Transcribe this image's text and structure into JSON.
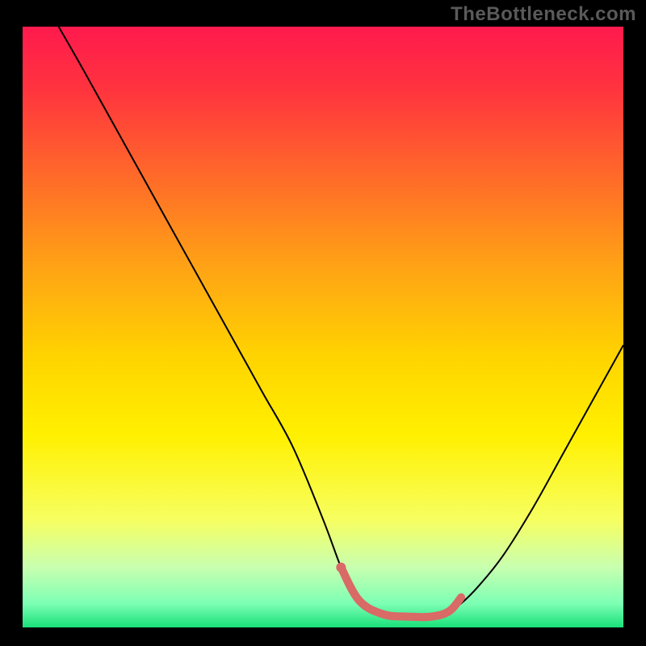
{
  "watermark": {
    "text": "TheBottleneck.com"
  },
  "chart_data": {
    "type": "line",
    "title": "",
    "xlabel": "",
    "ylabel": "",
    "xlim": [
      0,
      100
    ],
    "ylim": [
      0,
      100
    ],
    "background_gradient": {
      "stops": [
        {
          "offset": 0.0,
          "color": "#ff1a4d"
        },
        {
          "offset": 0.1,
          "color": "#ff323f"
        },
        {
          "offset": 0.25,
          "color": "#ff6a29"
        },
        {
          "offset": 0.4,
          "color": "#ffa315"
        },
        {
          "offset": 0.55,
          "color": "#ffd400"
        },
        {
          "offset": 0.68,
          "color": "#fff000"
        },
        {
          "offset": 0.82,
          "color": "#f7ff60"
        },
        {
          "offset": 0.9,
          "color": "#c8ffb0"
        },
        {
          "offset": 0.96,
          "color": "#7dffb4"
        },
        {
          "offset": 1.0,
          "color": "#19e07a"
        }
      ]
    },
    "series": [
      {
        "name": "bottleneck-curve",
        "color": "#000000",
        "width": 2,
        "x": [
          6,
          10,
          15,
          20,
          25,
          30,
          35,
          40,
          45,
          50,
          53,
          55,
          58,
          62,
          66,
          70,
          73,
          76,
          80,
          85,
          90,
          95,
          100
        ],
        "y": [
          100,
          93,
          84,
          75,
          66,
          57,
          48,
          39,
          30,
          18,
          10,
          6,
          3,
          1.5,
          1.5,
          2,
          4,
          7,
          12,
          20,
          29,
          38,
          47
        ]
      },
      {
        "name": "optimal-band",
        "color": "#d96a66",
        "width": 10,
        "linecap": "round",
        "x": [
          53,
          56,
          60,
          64,
          68,
          71,
          73
        ],
        "y": [
          10,
          4.5,
          2.2,
          1.8,
          1.8,
          2.7,
          5
        ]
      }
    ],
    "markers": [
      {
        "name": "optimal-dot",
        "x": 53,
        "y": 10,
        "r": 6,
        "color": "#d96a66"
      }
    ]
  }
}
